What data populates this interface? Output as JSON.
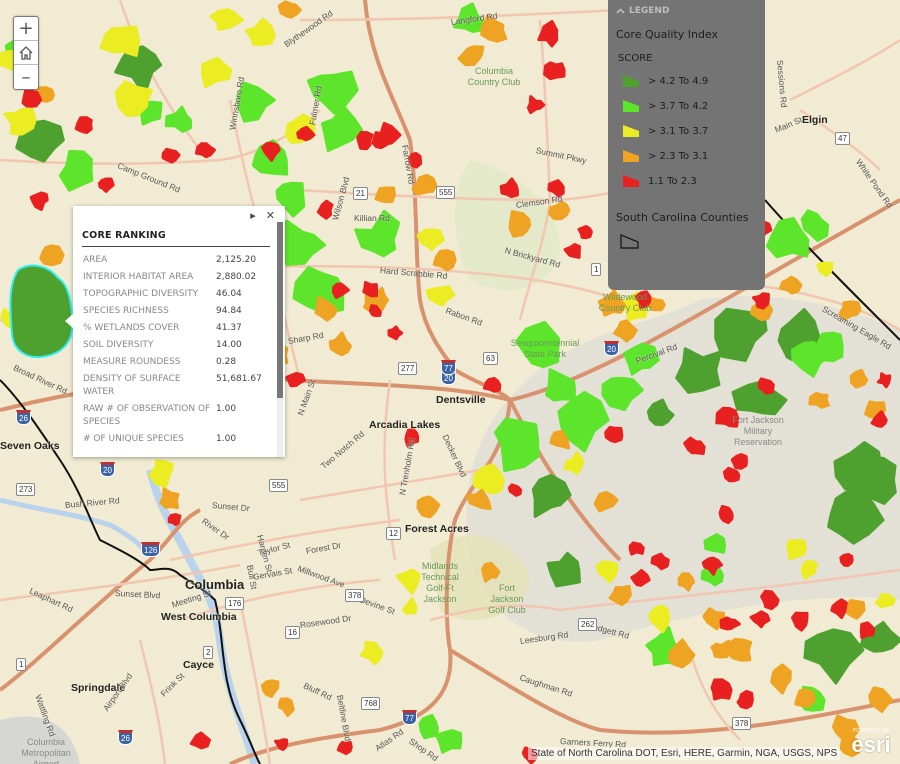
{
  "map": {
    "zoom_controls": {
      "zoom_in": "+",
      "home": "home",
      "zoom_out": "–"
    },
    "place_labels": [
      {
        "text": "Dentsville"
      },
      {
        "text": "Arcadia Lakes"
      },
      {
        "text": "Forest Acres"
      },
      {
        "text": "Columbia"
      },
      {
        "text": "West Columbia"
      },
      {
        "text": "Cayce"
      },
      {
        "text": "Springdale"
      },
      {
        "text": "Elgin"
      },
      {
        "text": "Seven Oaks"
      }
    ],
    "poi_labels": [
      {
        "text": "Columbia Country Club"
      },
      {
        "text": "Wildewood Country Club"
      },
      {
        "text": "Fort Jackson Military Reservation"
      },
      {
        "text": "Fort Jackson Golf Club"
      },
      {
        "text": "Midlands Technical Golf-Ft Jackson"
      },
      {
        "text": "Sesquicentennial State Park"
      },
      {
        "text": "Columbia Metropolitan Airport"
      }
    ],
    "road_labels": [
      "Langford Rd",
      "Blythewood Rd",
      "Summit Pkwy",
      "Clemson Rd",
      "Farrow Rd",
      "Killian Rd",
      "N Brickyard Rd",
      "Hard Scrabble Rd",
      "Wilson Blvd",
      "Fulmer Rd",
      "Sharp Rd",
      "Rabon Rd",
      "Camp Ground Rd",
      "Winnsboro Rd",
      "Broad River Rd",
      "Percival Rd",
      "Screaming Eagle Rd",
      "Two Notch Rd",
      "N Trenholm Rd",
      "Decker Blvd",
      "Forest Dr",
      "Millwood Ave",
      "Devine St",
      "Rosewood Dr",
      "Bluff Rd",
      "Garners Ferry Rd",
      "Leesburg Rd",
      "Caughman Rd",
      "Padgett Rd",
      "Sunset Blvd",
      "Bush River Rd",
      "Leaphart Rd",
      "Meeting St",
      "Gervais St",
      "Sunset Dr",
      "River Dr",
      "Main St",
      "Sessions Rd",
      "White Pond Rd",
      "N Main St",
      "Shop Rd",
      "Atlas Rd",
      "Wattling Rd",
      "Airport Blvd",
      "Frink St",
      "Bull St",
      "Taylor St",
      "Harden St",
      "Beltline Blvd"
    ],
    "route_shields": [
      "20",
      "77",
      "26",
      "126",
      "21",
      "555",
      "1",
      "12",
      "378",
      "16",
      "768",
      "262",
      "176",
      "2",
      "273",
      "47",
      "277",
      "63"
    ]
  },
  "legend": {
    "header": "LEGEND",
    "layer1_title": "Core Quality Index",
    "field": "SCORE",
    "classes": [
      {
        "label": "> 4.2 To 4.9",
        "color": "#4ea12f"
      },
      {
        "label": "> 3.7 To 4.2",
        "color": "#5ce52a"
      },
      {
        "label": "> 3.1 To 3.7",
        "color": "#ecec22"
      },
      {
        "label": "> 2.3 To 3.1",
        "color": "#efa322"
      },
      {
        "label": "1.1 To 2.3",
        "color": "#e82020"
      }
    ],
    "layer2_title": "South Carolina Counties"
  },
  "popup": {
    "title": "CORE RANKING",
    "rows": [
      {
        "label": "AREA",
        "value": "2,125.20"
      },
      {
        "label": "INTERIOR HABITAT AREA",
        "value": "2,880.02"
      },
      {
        "label": "TOPOGRAPHIC DIVERSITY",
        "value": "46.04"
      },
      {
        "label": "SPECIES RICHNESS",
        "value": "94.84"
      },
      {
        "label": "% WETLANDS COVER",
        "value": "41.37"
      },
      {
        "label": "SOIL DIVERSITY",
        "value": "14.00"
      },
      {
        "label": "MEASURE ROUNDESS",
        "value": "0.28"
      },
      {
        "label": "DENSITY OF SURFACE WATER",
        "value": "51,681.67"
      },
      {
        "label": "RAW # OF OBSERVATION OF SPECIES",
        "value": "1.00"
      },
      {
        "label": "# OF UNIQUE SPECIES",
        "value": "1.00"
      }
    ]
  },
  "attribution": "State of North Carolina DOT, Esri, HERE, Garmin, NGA, USGS, NPS",
  "esri": {
    "powered_by": "POWERED BY",
    "logo": "esri"
  },
  "colors": {
    "basemap": "#f0ebd2",
    "road_major": "#d9926e",
    "road_minor": "#f2c6b0",
    "water": "#b9d3ec",
    "park": "#dde8c4",
    "military": "#e3e0d6",
    "selected_outline": "#30f0f0"
  }
}
